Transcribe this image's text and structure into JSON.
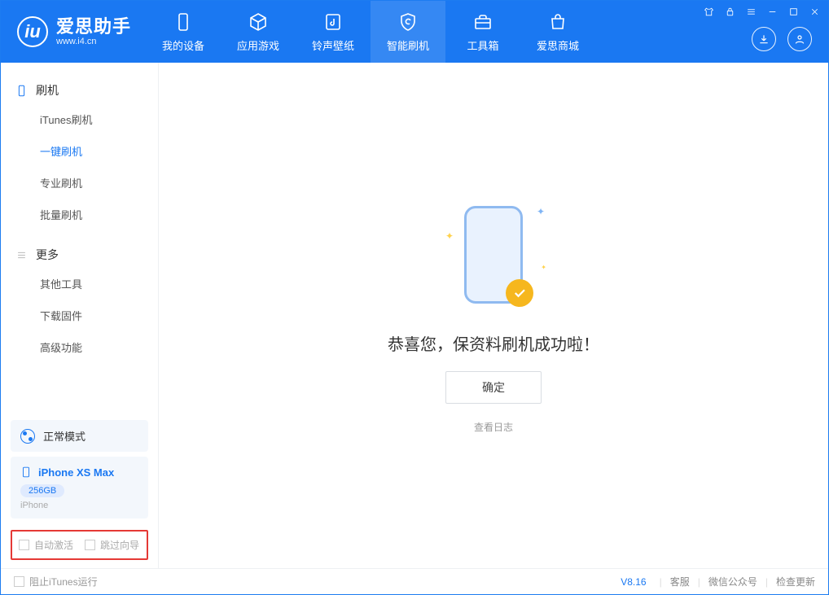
{
  "app": {
    "name": "爱思助手",
    "url": "www.i4.cn"
  },
  "tabs": [
    {
      "label": "我的设备"
    },
    {
      "label": "应用游戏"
    },
    {
      "label": "铃声壁纸"
    },
    {
      "label": "智能刷机"
    },
    {
      "label": "工具箱"
    },
    {
      "label": "爱思商城"
    }
  ],
  "sidebar": {
    "section1_title": "刷机",
    "section1_items": [
      "iTunes刷机",
      "一键刷机",
      "专业刷机",
      "批量刷机"
    ],
    "section2_title": "更多",
    "section2_items": [
      "其他工具",
      "下载固件",
      "高级功能"
    ]
  },
  "mode": {
    "label": "正常模式"
  },
  "device": {
    "name": "iPhone XS Max",
    "storage": "256GB",
    "type": "iPhone"
  },
  "options": {
    "auto_activate": "自动激活",
    "skip_guide": "跳过向导"
  },
  "main": {
    "success_text": "恭喜您，保资料刷机成功啦！",
    "ok_label": "确定",
    "log_link": "查看日志"
  },
  "footer": {
    "block_itunes": "阻止iTunes运行",
    "version": "V8.16",
    "support": "客服",
    "wechat": "微信公众号",
    "update": "检查更新"
  }
}
